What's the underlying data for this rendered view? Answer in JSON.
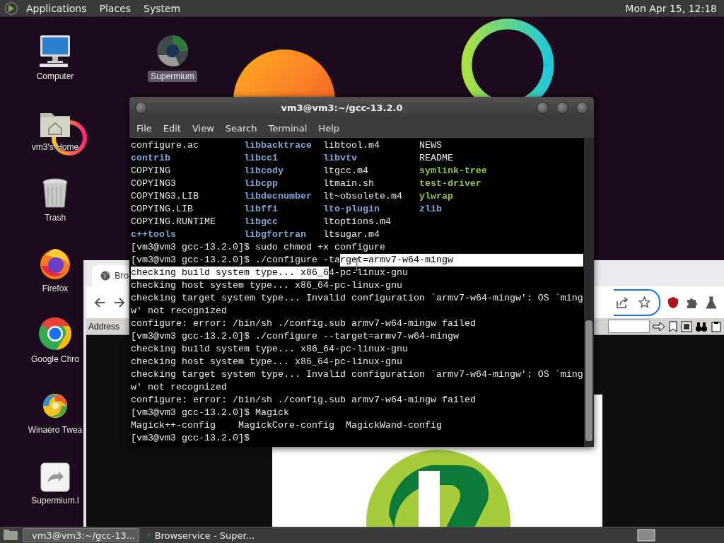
{
  "top_panel": {
    "menus": [
      "Applications",
      "Places",
      "System"
    ],
    "clock": "Mon Apr 15, 12:18"
  },
  "desktop_icons": [
    {
      "label": "Computer",
      "kind": "computer",
      "selected": false
    },
    {
      "label": "Supermium",
      "kind": "supermium",
      "selected": true
    },
    {
      "label": "vm3's Home",
      "kind": "home",
      "selected": false
    },
    {
      "label": "Trash",
      "kind": "trash",
      "selected": false
    },
    {
      "label": "Firefox",
      "kind": "firefox",
      "selected": false
    },
    {
      "label": "Google Chro",
      "kind": "chrome",
      "selected": false
    },
    {
      "label": "Winaero Twea",
      "kind": "winaero",
      "selected": false
    },
    {
      "label": "Supermium.l",
      "kind": "link",
      "selected": false
    }
  ],
  "browser": {
    "tab": {
      "title": "Bro"
    },
    "address_label": "Address"
  },
  "terminal": {
    "title": "vm3@vm3:~/gcc-13.2.0",
    "menus": [
      "File",
      "Edit",
      "View",
      "Search",
      "Terminal",
      "Help"
    ],
    "lines": [
      {
        "kind": "listing",
        "entries": [
          {
            "name": "configure.ac",
            "kind": "file"
          },
          {
            "name": "libbacktrace",
            "kind": "dir"
          },
          {
            "name": "libtool.m4",
            "kind": "file"
          },
          {
            "name": "NEWS",
            "kind": "file"
          }
        ]
      },
      {
        "kind": "listing",
        "entries": [
          {
            "name": "contrib",
            "kind": "dir"
          },
          {
            "name": "libcc1",
            "kind": "dir"
          },
          {
            "name": "libvtv",
            "kind": "dir"
          },
          {
            "name": "README",
            "kind": "file"
          }
        ]
      },
      {
        "kind": "listing",
        "entries": [
          {
            "name": "COPYING",
            "kind": "file"
          },
          {
            "name": "libcody",
            "kind": "dir"
          },
          {
            "name": "ltgcc.m4",
            "kind": "file"
          },
          {
            "name": "symlink-tree",
            "kind": "exec"
          }
        ]
      },
      {
        "kind": "listing",
        "entries": [
          {
            "name": "COPYING3",
            "kind": "file"
          },
          {
            "name": "libcpp",
            "kind": "dir"
          },
          {
            "name": "ltmain.sh",
            "kind": "file"
          },
          {
            "name": "test-driver",
            "kind": "exec"
          }
        ]
      },
      {
        "kind": "listing",
        "entries": [
          {
            "name": "COPYING3.LIB",
            "kind": "file"
          },
          {
            "name": "libdecnumber",
            "kind": "dir"
          },
          {
            "name": "lt~obsolete.m4",
            "kind": "file"
          },
          {
            "name": "ylwrap",
            "kind": "exec"
          }
        ]
      },
      {
        "kind": "listing",
        "entries": [
          {
            "name": "COPYING.LIB",
            "kind": "file"
          },
          {
            "name": "libffi",
            "kind": "dir"
          },
          {
            "name": "lto-plugin",
            "kind": "dir"
          },
          {
            "name": "zlib",
            "kind": "dir"
          }
        ]
      },
      {
        "kind": "listing",
        "entries": [
          {
            "name": "COPYING.RUNTIME",
            "kind": "file"
          },
          {
            "name": "libgcc",
            "kind": "dir"
          },
          {
            "name": "ltoptions.m4",
            "kind": "file"
          }
        ]
      },
      {
        "kind": "listing",
        "entries": [
          {
            "name": "c++tools",
            "kind": "dir"
          },
          {
            "name": "libgfortran",
            "kind": "dir"
          },
          {
            "name": "ltsugar.m4",
            "kind": "file"
          }
        ]
      },
      {
        "kind": "output",
        "segments": [
          {
            "text": "[vm3@vm3 gcc-13.2.0]$ sudo chmod +x configure",
            "selected": false
          }
        ]
      },
      {
        "kind": "output",
        "segments": [
          {
            "text": "[vm3@vm3 gcc-13.2.0]$ ./configure -ta",
            "selected": false
          },
          {
            "text": "rget=armv7-w64-mingw",
            "selected": true
          }
        ]
      },
      {
        "kind": "output",
        "segments": [
          {
            "text": "checking build system type... x86_6",
            "selected": true
          },
          {
            "text": "4-pc-linux-gnu",
            "selected": false
          }
        ]
      },
      {
        "kind": "output",
        "segments": [
          {
            "text": "checking host system type... x86_64-pc-linux-gnu",
            "selected": false
          }
        ]
      },
      {
        "kind": "output",
        "segments": [
          {
            "text": "checking target system type... Invalid configuration `armv7-w64-mingw': OS `ming",
            "selected": false
          }
        ]
      },
      {
        "kind": "output",
        "segments": [
          {
            "text": "w' not recognized",
            "selected": false
          }
        ]
      },
      {
        "kind": "output",
        "segments": [
          {
            "text": "configure: error: /bin/sh ./config.sub armv7-w64-mingw failed",
            "selected": false
          }
        ]
      },
      {
        "kind": "output",
        "segments": [
          {
            "text": "[vm3@vm3 gcc-13.2.0]$ ./configure --target=armv7-w64-mingw",
            "selected": false
          }
        ]
      },
      {
        "kind": "output",
        "segments": [
          {
            "text": "checking build system type... x86_64-pc-linux-gnu",
            "selected": false
          }
        ]
      },
      {
        "kind": "output",
        "segments": [
          {
            "text": "checking host system type... x86_64-pc-linux-gnu",
            "selected": false
          }
        ]
      },
      {
        "kind": "output",
        "segments": [
          {
            "text": "checking target system type... Invalid configuration `armv7-w64-mingw': OS `ming",
            "selected": false
          }
        ]
      },
      {
        "kind": "output",
        "segments": [
          {
            "text": "w' not recognized",
            "selected": false
          }
        ]
      },
      {
        "kind": "output",
        "segments": [
          {
            "text": "configure: error: /bin/sh ./config.sub armv7-w64-mingw failed",
            "selected": false
          }
        ]
      },
      {
        "kind": "output",
        "segments": [
          {
            "text": "[vm3@vm3 gcc-13.2.0]$ Magick",
            "selected": false
          }
        ]
      },
      {
        "kind": "output",
        "segments": [
          {
            "text": "Magick++-config    MagickCore-config  MagickWand-config",
            "selected": false
          }
        ]
      },
      {
        "kind": "output",
        "segments": [
          {
            "text": "[vm3@vm3 gcc-13.2.0]$",
            "selected": false
          }
        ]
      }
    ]
  },
  "taskbar": {
    "tasks": [
      {
        "label": "vm3@vm3:~/gcc-13...",
        "kind": "terminal",
        "selected": true
      },
      {
        "label": "Browservice - Super...",
        "kind": "browser",
        "selected": false
      }
    ]
  }
}
